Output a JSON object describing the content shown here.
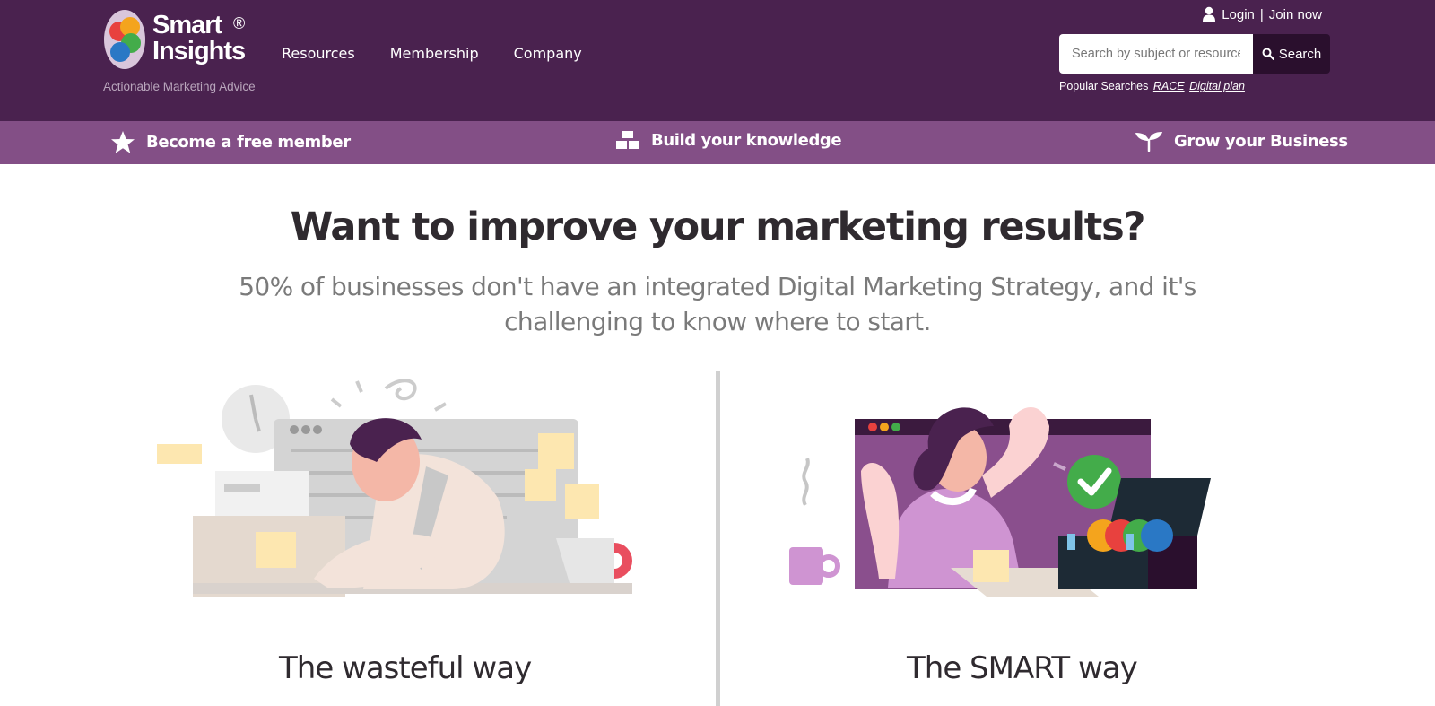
{
  "brand": {
    "name_line1": "Smart",
    "name_line2": "Insights",
    "registered": "®",
    "tagline": "Actionable Marketing Advice",
    "logo_colors": [
      "#e8413e",
      "#f4a41d",
      "#43ac4a",
      "#2a78c5"
    ]
  },
  "nav": {
    "items": [
      {
        "label": "Resources"
      },
      {
        "label": "Membership"
      },
      {
        "label": "Company"
      }
    ]
  },
  "user": {
    "login": "Login",
    "separator": "|",
    "join": "Join now",
    "icon": "user-icon"
  },
  "search": {
    "placeholder": "Search by subject or resource",
    "button_label": "Search",
    "icon": "search-icon",
    "popular_label": "Popular Searches",
    "popular_links": [
      "RACE",
      "Digital plan"
    ]
  },
  "subbar": {
    "items": [
      {
        "label": "Become a free member",
        "icon": "star-icon"
      },
      {
        "label": "Build your knowledge",
        "icon": "blocks-icon"
      },
      {
        "label": "Grow your Business",
        "icon": "sprout-icon"
      }
    ]
  },
  "hero": {
    "headline": "Want to improve your marketing results?",
    "subheadline": "50% of businesses don't have an integrated Digital Marketing Strategy, and it's challenging to know where to start."
  },
  "comparison": {
    "left_title": "The wasteful way",
    "right_title": "The SMART way"
  },
  "colors": {
    "header_bg": "#4a224f",
    "subbar_bg": "#834f86",
    "search_button": "#2a0f2d"
  }
}
